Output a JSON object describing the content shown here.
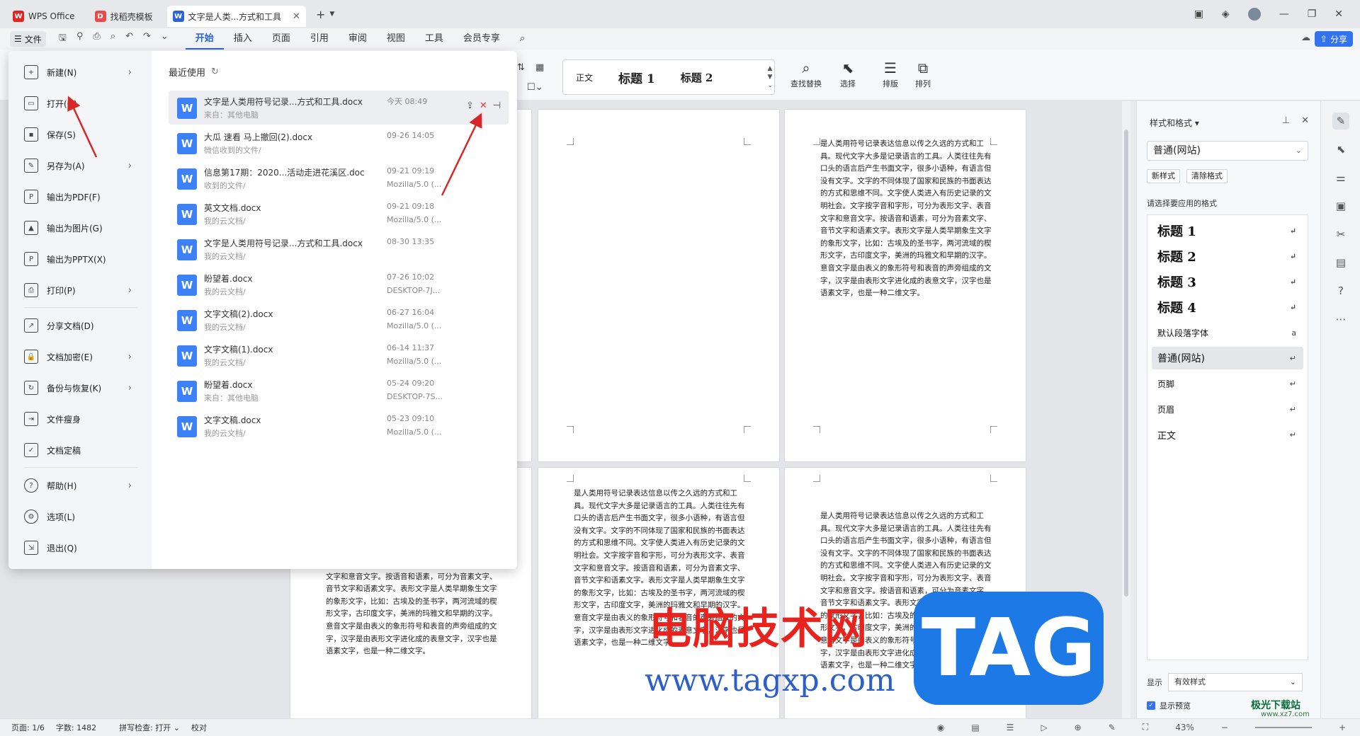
{
  "titlebar": {
    "tabs": [
      {
        "label": "WPS Office",
        "icon": "wps-logo"
      },
      {
        "label": "找稻壳模板",
        "icon": "docer-logo"
      },
      {
        "label": "文字是人类...方式和工具",
        "icon": "word-doc"
      }
    ],
    "new_tab": "+"
  },
  "menubar": {
    "file_label": "文件",
    "tabs": [
      "开始",
      "插入",
      "页面",
      "引用",
      "审阅",
      "视图",
      "工具",
      "会员专享"
    ],
    "active_tab": "开始",
    "share_label": "分享"
  },
  "ribbon": {
    "style_normal": "正文",
    "style_h1": "标题 1",
    "style_h2": "标题 2",
    "find_replace": "查找替换",
    "select": "选择",
    "layout": "排版",
    "arrange": "排列"
  },
  "file_menu": {
    "items": [
      {
        "label": "新建(N)",
        "icon": "new-file-icon",
        "has_arrow": true
      },
      {
        "label": "打开(O)",
        "icon": "folder-open-icon",
        "has_arrow": false
      },
      {
        "label": "保存(S)",
        "icon": "save-icon",
        "has_arrow": false
      },
      {
        "label": "另存为(A)",
        "icon": "save-as-icon",
        "has_arrow": true
      },
      {
        "label": "输出为PDF(F)",
        "icon": "pdf-icon",
        "has_arrow": false
      },
      {
        "label": "输出为图片(G)",
        "icon": "image-icon",
        "has_arrow": false
      },
      {
        "label": "输出为PPTX(X)",
        "icon": "pptx-icon",
        "has_arrow": false
      },
      {
        "label": "打印(P)",
        "icon": "print-icon",
        "has_arrow": true
      },
      {
        "label": "分享文档(D)",
        "icon": "share-icon",
        "has_arrow": false
      },
      {
        "label": "文档加密(E)",
        "icon": "lock-icon",
        "has_arrow": true
      },
      {
        "label": "备份与恢复(K)",
        "icon": "backup-icon",
        "has_arrow": true
      },
      {
        "label": "文件瘦身",
        "icon": "slim-icon",
        "has_arrow": false
      },
      {
        "label": "文档定稿",
        "icon": "finalize-icon",
        "has_arrow": false
      },
      {
        "label": "帮助(H)",
        "icon": "help-icon",
        "has_arrow": true
      },
      {
        "label": "选项(L)",
        "icon": "options-icon",
        "has_arrow": false
      },
      {
        "label": "退出(Q)",
        "icon": "exit-icon",
        "has_arrow": false
      }
    ],
    "recent_title": "最近使用",
    "recent": [
      {
        "name": "文字是人类用符号记录...方式和工具.docx",
        "source": "来自：其他电脑",
        "time": "今天 08:49",
        "from": ""
      },
      {
        "name": "大瓜 速看 马上撤回(2).docx",
        "source": "微信收到的文件/",
        "time": "09-26 14:05",
        "from": ""
      },
      {
        "name": "信息第17期：2020...活动走进花溪区.doc",
        "source": "收到的文件/",
        "time": "09-21 09:19",
        "from": "Mozilla/5.0 (..."
      },
      {
        "name": "英文文档.docx",
        "source": "我的云文档/",
        "time": "09-21 09:18",
        "from": "Mozilla/5.0 (..."
      },
      {
        "name": "文字是人类用符号记录...方式和工具.docx",
        "source": "我的云文档/",
        "time": "08-30 13:35",
        "from": ""
      },
      {
        "name": "盼望着.docx",
        "source": "我的云文档/",
        "time": "07-26 10:02",
        "from": "DESKTOP-7J..."
      },
      {
        "name": "文字文稿(2).docx",
        "source": "我的云文档/",
        "time": "06-27 16:04",
        "from": "Mozilla/5.0 (..."
      },
      {
        "name": "文字文稿(1).docx",
        "source": "我的云文档/",
        "time": "06-14 11:37",
        "from": "Mozilla/5.0 (..."
      },
      {
        "name": "盼望着.docx",
        "source": "来自：其他电脑",
        "time": "05-24 09:20",
        "from": "DESKTOP-7S..."
      },
      {
        "name": "文字文稿.docx",
        "source": "我的云文档/",
        "time": "05-23 09:10",
        "from": "Mozilla/5.0 (..."
      }
    ]
  },
  "document": {
    "paragraph": "是人类用符号记录表达信息以传之久远的方式和工具。现代文字大多是记录语言的工具。人类往往先有口头的语言后产生书面文字，很多小语种，有语言但没有文字。文字的不同体现了国家和民族的书面表达的方式和思维不同。文字使人类进入有历史记录的文明社会。文字按字音和字形，可分为表形文字、表音文字和意音文字。按语音和语素，可分为音素文字、音节文字和语素文字。表形文字是人类早期象生文字的象形文字，比如：古埃及的圣书字，两河流域的楔形文字，古印度文字，美洲的玛雅文和早期的汉字。意音文字是由表义的象形符号和表音的声旁组成的文字，汉字是由表形文字进化成的表意文字，汉字也是语素文字，也是一种二维文字。"
  },
  "styles_panel": {
    "title": "样式和格式",
    "current": "普通(网站)",
    "new_style": "新样式",
    "clear_format": "清除格式",
    "prompt": "请选择要应用的格式",
    "styles": [
      {
        "label": "标题 1",
        "heading": true
      },
      {
        "label": "标题 2",
        "heading": true
      },
      {
        "label": "标题 3",
        "heading": true
      },
      {
        "label": "标题 4",
        "heading": true
      },
      {
        "label": "默认段落字体",
        "heading": false
      },
      {
        "label": "普通(网站)",
        "heading": false
      },
      {
        "label": "页脚",
        "heading": false
      },
      {
        "label": "页眉",
        "heading": false
      },
      {
        "label": "正文",
        "heading": false
      }
    ],
    "show_label": "显示",
    "show_value": "有效样式",
    "preview_label": "显示预览"
  },
  "statusbar": {
    "page": "页面: 1/6",
    "words": "字数: 1482",
    "spell": "拼写检查: 打开",
    "proof": "校对",
    "zoom": "43%"
  },
  "watermark": {
    "cn_text": "电脑技术网",
    "url": "www.tagxp.com",
    "tag": "TAG",
    "corner": "极光下载站",
    "corner_url": "www.xz7.com"
  },
  "colors": {
    "accent": "#2b63d9",
    "wps_red": "#e8231d",
    "annotation_arrow": "#d62828"
  }
}
